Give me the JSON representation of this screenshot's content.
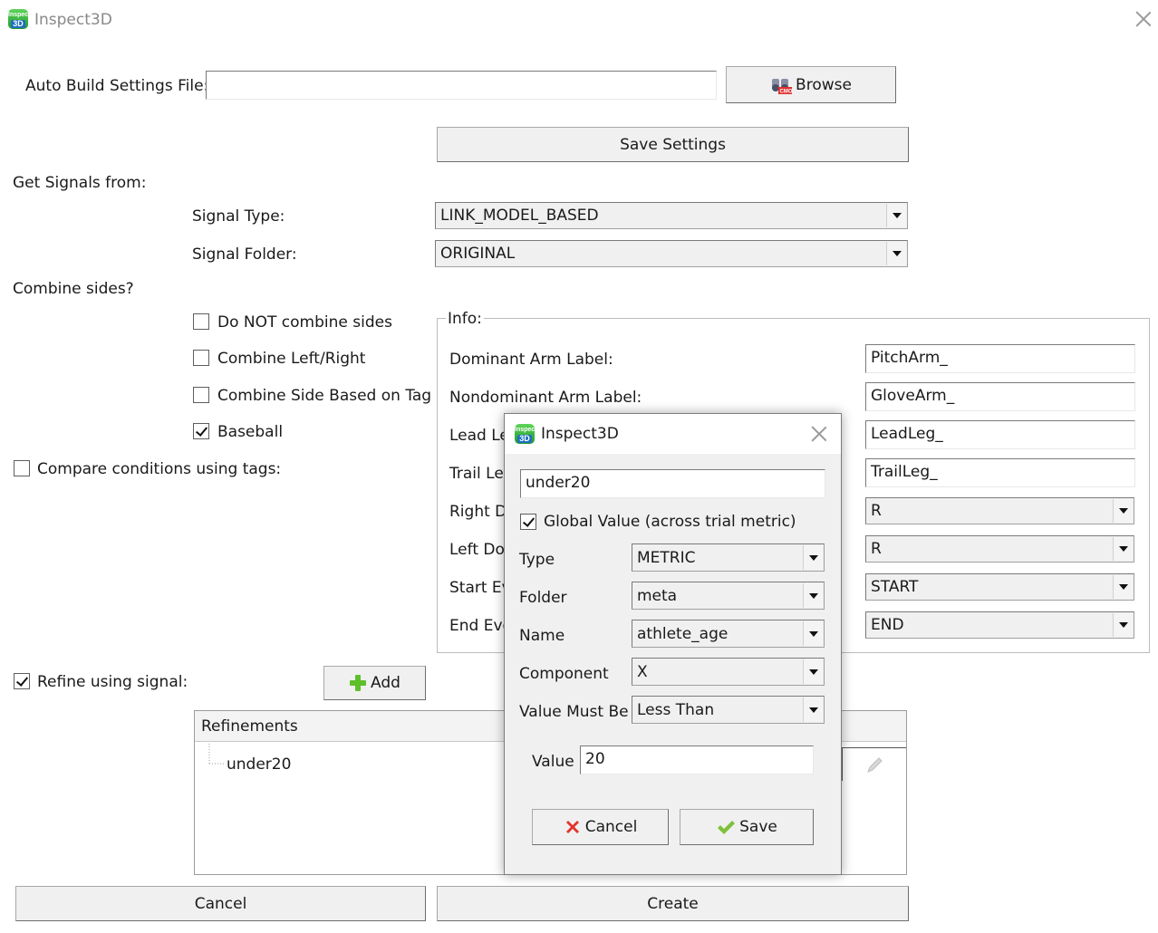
{
  "window": {
    "title": "Inspect3D",
    "icon_text_top": "Inspect",
    "icon_text_bottom": "3D"
  },
  "auto_build": {
    "label": "Auto Build Settings File:",
    "value": "",
    "browse_label": "Browse"
  },
  "save_settings_label": "Save Settings",
  "get_signals": {
    "heading": "Get Signals from:",
    "signal_type_label": "Signal Type:",
    "signal_type_value": "LINK_MODEL_BASED",
    "signal_folder_label": "Signal Folder:",
    "signal_folder_value": "ORIGINAL"
  },
  "combine": {
    "heading": "Combine sides?",
    "options": [
      {
        "label": "Do NOT combine sides",
        "checked": false
      },
      {
        "label": "Combine Left/Right",
        "checked": false
      },
      {
        "label": "Combine Side Based on Tag",
        "checked": false
      },
      {
        "label": "Baseball",
        "checked": true
      }
    ]
  },
  "compare_conditions": {
    "label": "Compare conditions using tags:",
    "checked": false
  },
  "info": {
    "title": "Info:",
    "rows": [
      {
        "label": "Dominant Arm Label:",
        "value": "PitchArm_"
      },
      {
        "label": "Nondominant Arm Label:",
        "value": "GloveArm_"
      },
      {
        "label": "Lead Le",
        "value": "LeadLeg_"
      },
      {
        "label": "Trail Leg",
        "value": "TrailLeg_"
      },
      {
        "label": "Right D",
        "value": "R"
      },
      {
        "label": "Left Dor",
        "value": "R"
      },
      {
        "label": "Start Ev",
        "value": "START"
      },
      {
        "label": "End Eve",
        "value": "END"
      }
    ]
  },
  "refine": {
    "label": "Refine using signal:",
    "checked": true,
    "add_label": "Add"
  },
  "refinements": {
    "header": "Refinements",
    "items": [
      "under20"
    ]
  },
  "bottom": {
    "cancel_label": "Cancel",
    "create_label": "Create"
  },
  "dialog": {
    "title": "Inspect3D",
    "name_value": "under20",
    "global_label": "Global Value (across trial metric)",
    "global_checked": true,
    "type_label": "Type",
    "type_value": "METRIC",
    "folder_label": "Folder",
    "folder_value": "meta",
    "name_label": "Name",
    "name_select_value": "athlete_age",
    "component_label": "Component",
    "component_value": "X",
    "must_be_label": "Value Must Be",
    "must_be_value": "Less Than",
    "value_label": "Value",
    "value_value": "20",
    "cancel_label": "Cancel",
    "save_label": "Save"
  }
}
